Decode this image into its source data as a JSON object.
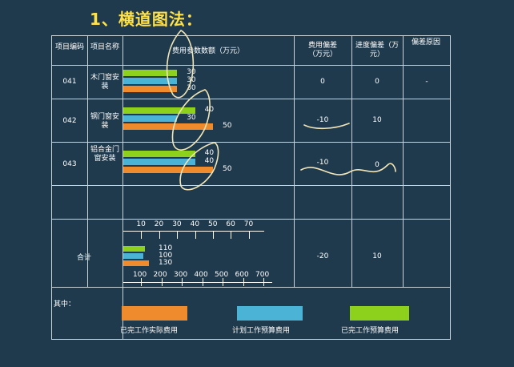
{
  "title": "1、横道图法：",
  "headers": {
    "code": "项目编码",
    "name": "项目名称",
    "cost": "费用参数数额（万元）",
    "cost_dev": "费用偏差（万元）",
    "schedule_dev": "进度偏差（万元）",
    "reason": "偏差原因"
  },
  "rows": [
    {
      "code": "041",
      "name": "木门窗安装",
      "bars": [
        30,
        30,
        30
      ],
      "labels": [
        "30",
        "30",
        "30"
      ],
      "cost_dev": "0",
      "schedule_dev": "0",
      "reason": "-"
    },
    {
      "code": "042",
      "name": "钢门窗安装",
      "bars": [
        40,
        30,
        50
      ],
      "labels": [
        "40",
        "30",
        "50"
      ],
      "cost_dev": "-10",
      "schedule_dev": "10",
      "reason": ""
    },
    {
      "code": "043",
      "name": "铝合金门窗安装",
      "bars": [
        40,
        40,
        50
      ],
      "labels": [
        "40",
        "40",
        "50"
      ],
      "cost_dev": "-10",
      "schedule_dev": "0",
      "reason": ""
    }
  ],
  "scale_top": {
    "ticks": [
      "10",
      "20",
      "30",
      "40",
      "50",
      "60",
      "70"
    ]
  },
  "total": {
    "label": "合计",
    "bars": [
      110,
      100,
      130
    ],
    "labels": [
      "110",
      "100",
      "130"
    ],
    "cost_dev": "-20",
    "schedule_dev": "10"
  },
  "scale_bottom": {
    "ticks": [
      "100",
      "200",
      "300",
      "400",
      "500",
      "600",
      "700"
    ]
  },
  "legend": {
    "prefix": "其中：",
    "items": [
      {
        "label": "已完工作实际费用",
        "color": "#f08b2d"
      },
      {
        "label": "计划工作预算费用",
        "color": "#4ab3d6"
      },
      {
        "label": "已完工作预算费用",
        "color": "#8ed11c"
      }
    ]
  },
  "colors": {
    "background": "#1f3a4d",
    "title": "#ffe14a",
    "grid": "#c7d2d9",
    "ink": "#f2e6b8"
  }
}
